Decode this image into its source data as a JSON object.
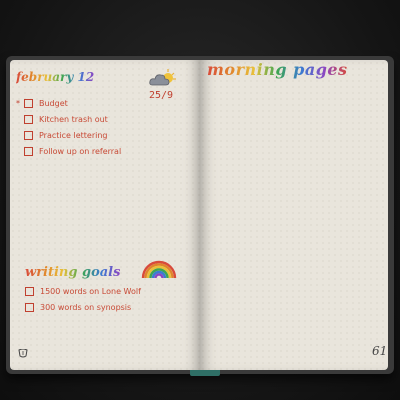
{
  "left_page": {
    "date_title": "february 12",
    "day_label": "25/9",
    "weather": "cloud-sun-icon",
    "tasks": [
      {
        "marker": "*",
        "text": "Budget"
      },
      {
        "marker": "",
        "text": "Kitchen trash out"
      },
      {
        "marker": "",
        "text": "Practice lettering"
      },
      {
        "marker": "",
        "text": "Follow up on referral"
      }
    ],
    "goals_title": "writing goals",
    "goals": [
      {
        "text": "1500 words on Lone Wolf"
      },
      {
        "text": "300 words on synopsis"
      }
    ]
  },
  "right_page": {
    "title": "morning pages",
    "page_number": "61"
  },
  "colors": {
    "ink": "#c84a36",
    "paper": "#e9e5dc",
    "band": "#2f6f66"
  }
}
